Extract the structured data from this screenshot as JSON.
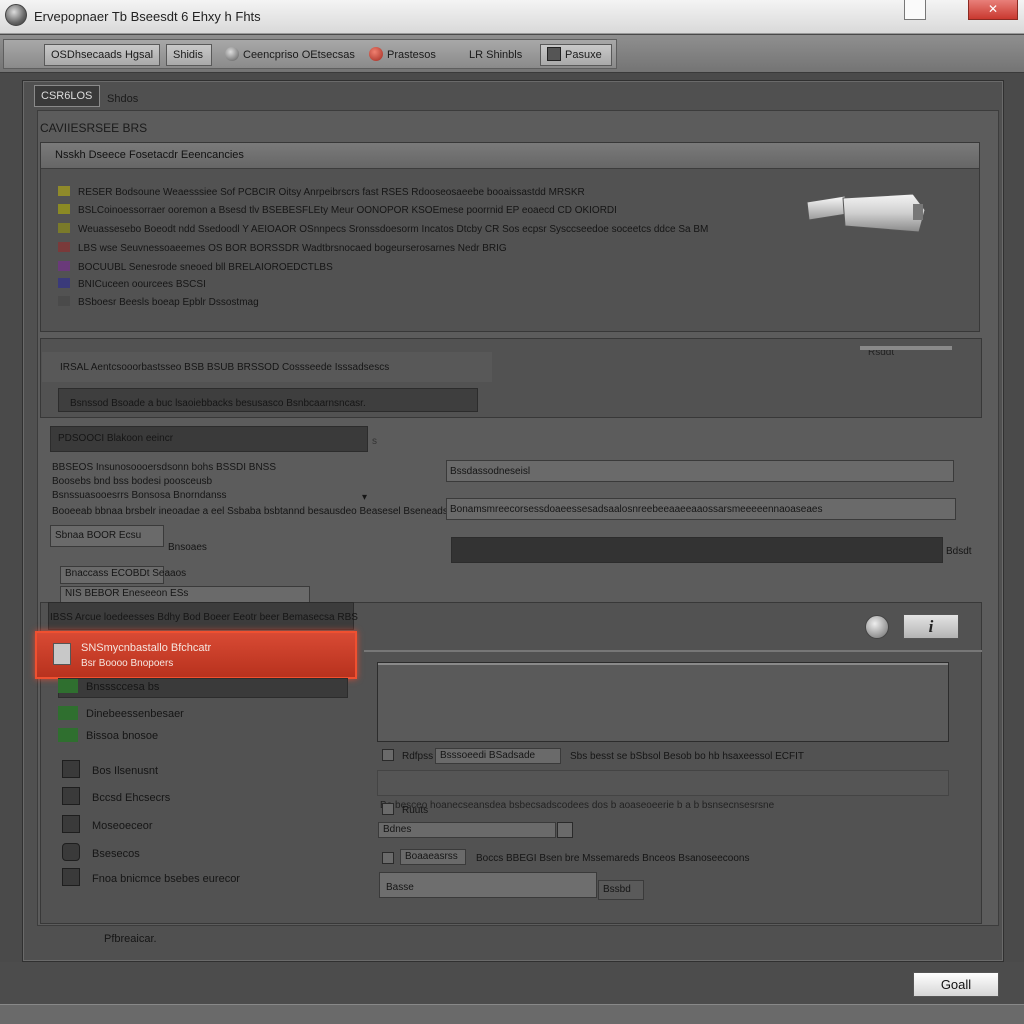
{
  "window": {
    "title": "Ervepopnaer Tb Bseesdt 6 Ehxy h Fhts"
  },
  "toolbar": {
    "btn1": "OSDhsecaads Hgsal",
    "btn2": "Shidis",
    "btn3": "Ceencpriso OEtsecsas",
    "btn4": "Prastesos",
    "btn5": "LR Shinbls",
    "btn6": "Pasuxe"
  },
  "tabs": {
    "active": "CSR6LOS",
    "second": "Shdos"
  },
  "group_label": "CAVIIESRSEE BRS",
  "device_panel": {
    "heading": "Nsskh Dseece Fosetacdr Eeencancies",
    "rows": [
      {
        "text": "RESER Bodsoune Weaesssiee Sof PCBCIR Oitsy Anrpeibrscrs fast RSES Rdooseosaeebe booaissastdd MRSKR",
        "color": "#8f8a2a"
      },
      {
        "text": "BSLCoinoessorraer ooremon a Bsesd tlv BSEBESFLEty Meur OONOPOR KSOEmese poorrnid EP eoaecd CD OKIORDI",
        "color": "#8b8a24"
      },
      {
        "text": "Weuassesebo Boeodt ndd Ssedoodl Y AEIOAOR OSnnpecs Sronssdoesorm Incatos Dtcby CR Sos ecpsr Sysccseedoe soceetcs ddce Sa BM",
        "color": "#7a7a2a"
      },
      {
        "text": "LBS wse Seuvnessoaeemes OS BOR BORSSDR Wadtbrsnocaed bogeurserosarnes Nedr BRIG",
        "color": "#7a3a3a"
      },
      {
        "text": "BOCUUBL Senesrode sneoed bll BRELAIOROEDCTLBS",
        "color": "#6a3a7a"
      },
      {
        "text": "BNICuceen oourcees BSCSI",
        "color": "#3a3a7a"
      },
      {
        "text": "BSboesr Beesls boeap Epblr Dssostmag",
        "color": "#4a4a4a"
      }
    ]
  },
  "section2": {
    "heading": "IRSAL Aentcsooorbastsseo BSB BSUB BRSSOD Cossseede Isssadsescs",
    "subtext": "Bsnssod Bsoade a buc lsaoiebbacks besusasco Bsnbcaarnsncasr.",
    "right_tag": "Rsddt"
  },
  "form": {
    "group_label": "PDSOOCI Blakoon eeincr",
    "line1": "BBSEOS Insunosoooersdsonn bohs BSSDI BNSS",
    "line2": "Boosebs bnd bss bodesi poosceusb",
    "line3": "Bsnssuasooesrrs Bonsosa Bnorndanss",
    "line4": "Booeeab bbnaa brsbelr ineoadae a eel Ssbaba bsbtannd besausdeo Beasesel Bseneadsse Bseass",
    "select1": "Sbnaa BOOR Ecsu",
    "select1_aside": "Bnsoaes",
    "select2": "Bnaccass ECOBDt Seaaos",
    "select3": "NIS BEBOR Eneseeon ESs",
    "right_value1": "Bssdassodneseisl",
    "right_value2": "Bonamsmreecorsessdoaeessesadsaalosnreebeeaaeeaaossarsmeeeeennaoaseaes",
    "right_unit": "Bdsdt"
  },
  "lower": {
    "header_text": "IBSS Arcue loedeesses Bdhy Bod Boeer Eeotr beer Bemasecsa RBS",
    "highlight_line1": "SNSmycnbastallo Bfchcatr",
    "highlight_line2": "Bsr Boooo Bnopoers",
    "green_items": [
      "Bnsssccesa bs",
      "Dinebeessenbesaer",
      "Bissoa bnosoe"
    ],
    "side_items": [
      "Bos Ilsenusnt",
      "Bccsd Ehcsecrs",
      "Moseoeceor",
      "Bsesecos",
      "Fnoa bnicmce bsebes eurecor"
    ]
  },
  "right_panel": {
    "info_button": "i",
    "check1_label": "Rdfpss",
    "check1_field": "Bsssoeedi BSadsade",
    "check1_desc": "Sbs besst se bSbsol Besob bo hb hsaxeessol ECFIT",
    "note_line": "Bo besceo hoanecseansdea bsbecsadscodees dos b aoaseoeerie b a b bsnsecnsesrsne",
    "check2_label": "Ruuts",
    "select_value": "Bdnes",
    "check3_field": "Boaaeasrss",
    "check3_desc": "Boccs BBEGI Bsen bre Mssemareds Bnceos Bsanoseecoons",
    "field_value": "Basse",
    "field_button": "Bssbd"
  },
  "status_text": "Pfbreaicar.",
  "footer": {
    "ok_label": "Goall"
  }
}
